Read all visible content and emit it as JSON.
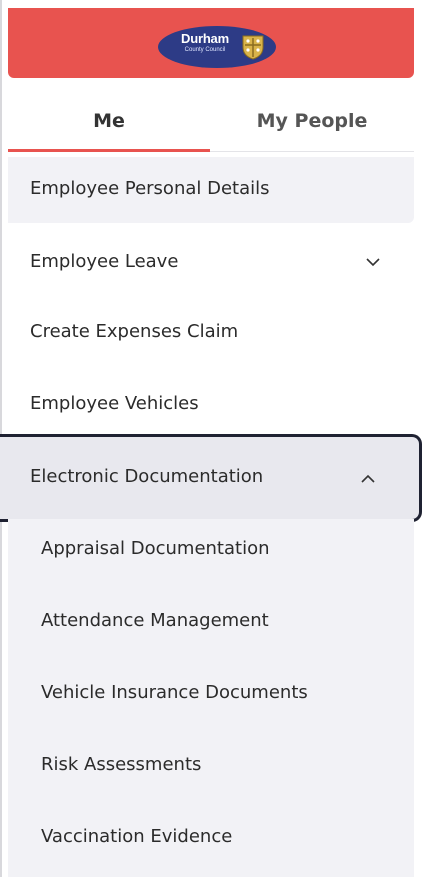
{
  "header": {
    "logo_name": "Durham",
    "logo_sub": "County Council"
  },
  "tabs": [
    {
      "label": "Me",
      "active": true
    },
    {
      "label": "My People",
      "active": false
    }
  ],
  "nav": {
    "items": [
      {
        "label": "Employee Personal Details"
      },
      {
        "label": "Employee Leave",
        "icon": "chevron-down-icon"
      },
      {
        "label": "Create Expenses Claim"
      },
      {
        "label": "Employee Vehicles"
      },
      {
        "label": "Electronic Documentation",
        "icon": "chevron-up-icon",
        "expanded": true
      }
    ],
    "sub_items": [
      {
        "label": "Appraisal Documentation"
      },
      {
        "label": "Attendance Management"
      },
      {
        "label": "Vehicle Insurance Documents"
      },
      {
        "label": "Risk Assessments"
      },
      {
        "label": "Vaccination Evidence"
      }
    ]
  },
  "colors": {
    "brand": "#e8534f",
    "logo_bg": "#2d3b86",
    "selected_bg": "#f2f2f6",
    "focus_border": "#1f2232"
  }
}
